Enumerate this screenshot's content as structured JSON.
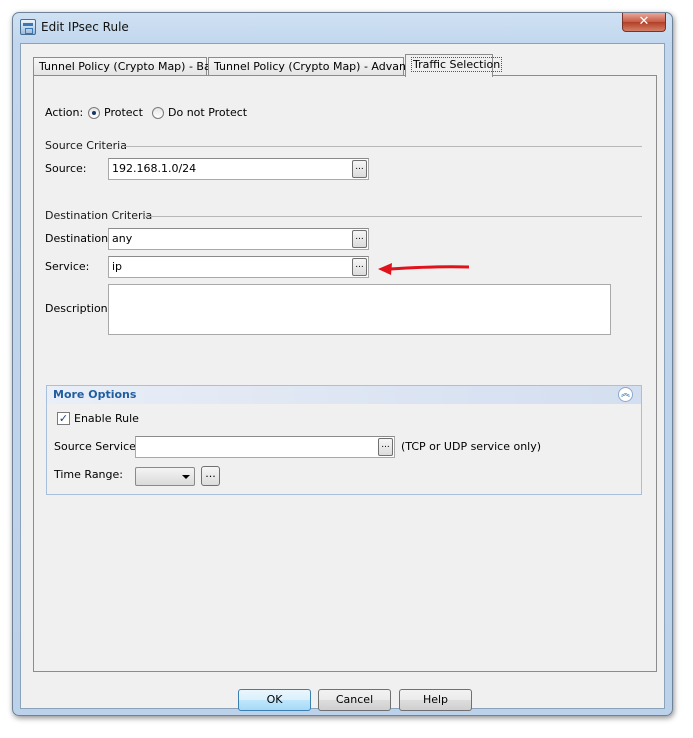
{
  "window": {
    "title": "Edit IPsec Rule",
    "close_label": "✕"
  },
  "tabs": [
    {
      "label": "Tunnel Policy (Crypto Map) - Basic"
    },
    {
      "label": "Tunnel Policy (Crypto Map) - Advanced"
    },
    {
      "label": "Traffic Selection"
    }
  ],
  "action": {
    "label": "Action:",
    "options": [
      {
        "label": "Protect",
        "selected": true
      },
      {
        "label": "Do not Protect",
        "selected": false
      }
    ]
  },
  "source_criteria": {
    "title": "Source Criteria",
    "source_label": "Source:",
    "source_value": "192.168.1.0/24"
  },
  "destination_criteria": {
    "title": "Destination Criteria",
    "destination_label": "Destination:",
    "destination_value": "any",
    "service_label": "Service:",
    "service_value": "ip",
    "description_label": "Description:",
    "description_value": ""
  },
  "browse_glyph": "...",
  "more_options": {
    "title": "More Options",
    "enable_rule_label": "Enable Rule",
    "enable_rule_checked": true,
    "source_service_label": "Source Service:",
    "source_service_value": "",
    "source_service_hint": "(TCP or UDP service only)",
    "time_range_label": "Time Range:",
    "time_range_value": ""
  },
  "buttons": {
    "ok": "OK",
    "cancel": "Cancel",
    "help": "Help"
  },
  "colors": {
    "annotation_arrow": "#e0121c",
    "section_accent": "#215ea0"
  }
}
